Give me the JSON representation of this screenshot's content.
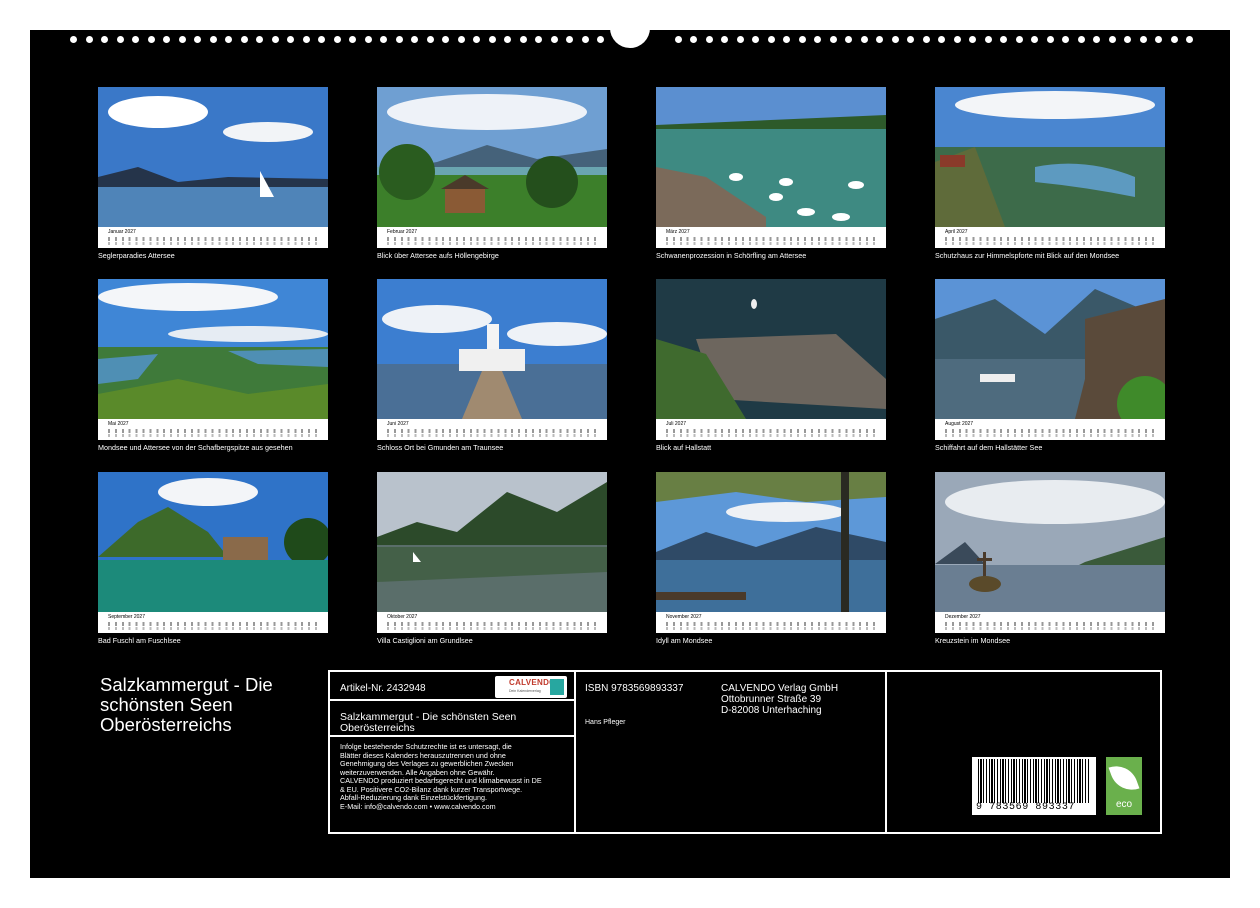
{
  "calendar": {
    "title": "Salzkammergut - Die schönsten Seen Oberösterreichs",
    "months": [
      {
        "month": "Januar 2027",
        "caption": "Seglerparadies Attersee"
      },
      {
        "month": "Februar 2027",
        "caption": "Blick über Attersee aufs Höllengebirge"
      },
      {
        "month": "März 2027",
        "caption": "Schwanenprozession in Schörfling am Attersee"
      },
      {
        "month": "April 2027",
        "caption": "Schutzhaus zur Himmelspforte mit Blick auf den Mondsee"
      },
      {
        "month": "Mai 2027",
        "caption": "Mondsee und Attersee von der Schafbergspitze aus gesehen"
      },
      {
        "month": "Juni 2027",
        "caption": "Schloss Ort bei Gmunden am Traunsee"
      },
      {
        "month": "Juli 2027",
        "caption": "Blick auf Hallstatt"
      },
      {
        "month": "August 2027",
        "caption": "Schiffahrt auf dem Hallstätter See"
      },
      {
        "month": "September 2027",
        "caption": "Bad Fuschl am Fuschlsee"
      },
      {
        "month": "Oktober 2027",
        "caption": "Villa Castiglioni am Grundlsee"
      },
      {
        "month": "November 2027",
        "caption": "Idyll am Mondsee"
      },
      {
        "month": "Dezember 2027",
        "caption": "Kreuzstein im Mondsee"
      }
    ]
  },
  "info": {
    "article": "Artikel-Nr. 2432948",
    "logo_name": "CALVENDO",
    "logo_sub": "Dein Kalenderverlag",
    "title": "Salzkammergut - Die schönsten Seen Oberösterreichs",
    "legal": [
      "Infolge bestehender Schutzrechte ist es untersagt, die",
      "Blätter dieses Kalenders herauszutrennen und ohne",
      "Genehmigung des Verlages zu gewerblichen Zwecken",
      "weiterzuverwenden. Alle Angaben ohne Gewähr.",
      "CALVENDO produziert bedarfsgerecht und klimabewusst in DE",
      "& EU. Positivere CO2-Bilanz dank kurzer Transportwege.",
      "Abfall-Reduzierung dank Einzelstückfertigung.",
      "E-Mail: info@calvendo.com • www.calvendo.com"
    ],
    "isbn": "ISBN 9783569893337",
    "author": "Hans Pfleger",
    "publisher": [
      "CALVENDO Verlag GmbH",
      "Ottobrunner Straße 39",
      "D-82008 Unterhaching"
    ],
    "barcode_number": "9 783569 893337",
    "eco_label": "eco"
  }
}
